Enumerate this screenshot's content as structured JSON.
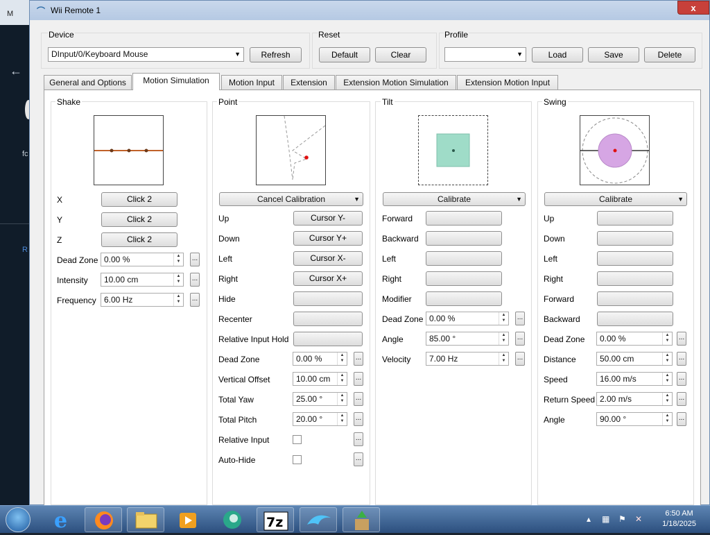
{
  "window": {
    "title": "Wii Remote 1",
    "close": "x"
  },
  "device": {
    "group_label": "Device",
    "selected": "DInput/0/Keyboard Mouse",
    "refresh": "Refresh"
  },
  "reset": {
    "group_label": "Reset",
    "default": "Default",
    "clear": "Clear"
  },
  "profile": {
    "group_label": "Profile",
    "selected": "",
    "load": "Load",
    "save": "Save",
    "delete": "Delete"
  },
  "tabs": [
    {
      "label": "General and Options",
      "active": false
    },
    {
      "label": "Motion Simulation",
      "active": true
    },
    {
      "label": "Motion Input",
      "active": false
    },
    {
      "label": "Extension",
      "active": false
    },
    {
      "label": "Extension Motion Simulation",
      "active": false
    },
    {
      "label": "Extension Motion Input",
      "active": false
    }
  ],
  "shake": {
    "title": "Shake",
    "rows": [
      {
        "label": "X",
        "value": "Click 2"
      },
      {
        "label": "Y",
        "value": "Click 2"
      },
      {
        "label": "Z",
        "value": "Click 2"
      }
    ],
    "settings": [
      {
        "label": "Dead Zone",
        "value": "0.00 %"
      },
      {
        "label": "Intensity",
        "value": "10.00 cm"
      },
      {
        "label": "Frequency",
        "value": "6.00 Hz"
      }
    ]
  },
  "point": {
    "title": "Point",
    "calibration": "Cancel Calibration",
    "rows": [
      {
        "label": "Up",
        "value": "Cursor Y-"
      },
      {
        "label": "Down",
        "value": "Cursor Y+"
      },
      {
        "label": "Left",
        "value": "Cursor X-"
      },
      {
        "label": "Right",
        "value": "Cursor X+"
      },
      {
        "label": "Hide",
        "value": ""
      },
      {
        "label": "Recenter",
        "value": ""
      },
      {
        "label": "Relative Input Hold",
        "value": ""
      }
    ],
    "settings": [
      {
        "label": "Dead Zone",
        "value": "0.00 %"
      },
      {
        "label": "Vertical Offset",
        "value": "10.00 cm"
      },
      {
        "label": "Total Yaw",
        "value": "25.00 °"
      },
      {
        "label": "Total Pitch",
        "value": "20.00 °"
      }
    ],
    "checks": [
      {
        "label": "Relative Input",
        "checked": false
      },
      {
        "label": "Auto-Hide",
        "checked": false
      }
    ]
  },
  "tilt": {
    "title": "Tilt",
    "calibration": "Calibrate",
    "rows": [
      {
        "label": "Forward",
        "value": ""
      },
      {
        "label": "Backward",
        "value": ""
      },
      {
        "label": "Left",
        "value": ""
      },
      {
        "label": "Right",
        "value": ""
      },
      {
        "label": "Modifier",
        "value": ""
      }
    ],
    "settings": [
      {
        "label": "Dead Zone",
        "value": "0.00 %"
      },
      {
        "label": "Angle",
        "value": "85.00 °"
      },
      {
        "label": "Velocity",
        "value": "7.00 Hz"
      }
    ]
  },
  "swing": {
    "title": "Swing",
    "calibration": "Calibrate",
    "rows": [
      {
        "label": "Up",
        "value": ""
      },
      {
        "label": "Down",
        "value": ""
      },
      {
        "label": "Left",
        "value": ""
      },
      {
        "label": "Right",
        "value": ""
      },
      {
        "label": "Forward",
        "value": ""
      },
      {
        "label": "Backward",
        "value": ""
      }
    ],
    "settings": [
      {
        "label": "Dead Zone",
        "value": "0.00 %"
      },
      {
        "label": "Distance",
        "value": "50.00 cm"
      },
      {
        "label": "Speed",
        "value": "16.00 m/s"
      },
      {
        "label": "Return Speed",
        "value": "2.00 m/s"
      },
      {
        "label": "Angle",
        "value": "90.00 °"
      }
    ]
  },
  "spin_glyphs": {
    "up": "▲",
    "down": "▼",
    "more": "...",
    "drop": "▼"
  },
  "background": {
    "left_text_1": "fc",
    "left_text_2": "R",
    "arrow": "←",
    "m": "M"
  },
  "taskbar": {
    "items": [
      "windows-start",
      "internet-explorer",
      "firefox",
      "file-explorer",
      "media-player",
      "video-app",
      "7zip",
      "dolphin",
      "installer"
    ],
    "sevenzip": "7z",
    "time": "6:50 AM",
    "date": "1/18/2025"
  },
  "colors": {
    "accent_tilt": "#9fdcc8",
    "accent_swing": "#d6a6e4",
    "shake_line": "#c0622a",
    "point_dot": "#e01010",
    "close": "#c7403a"
  }
}
